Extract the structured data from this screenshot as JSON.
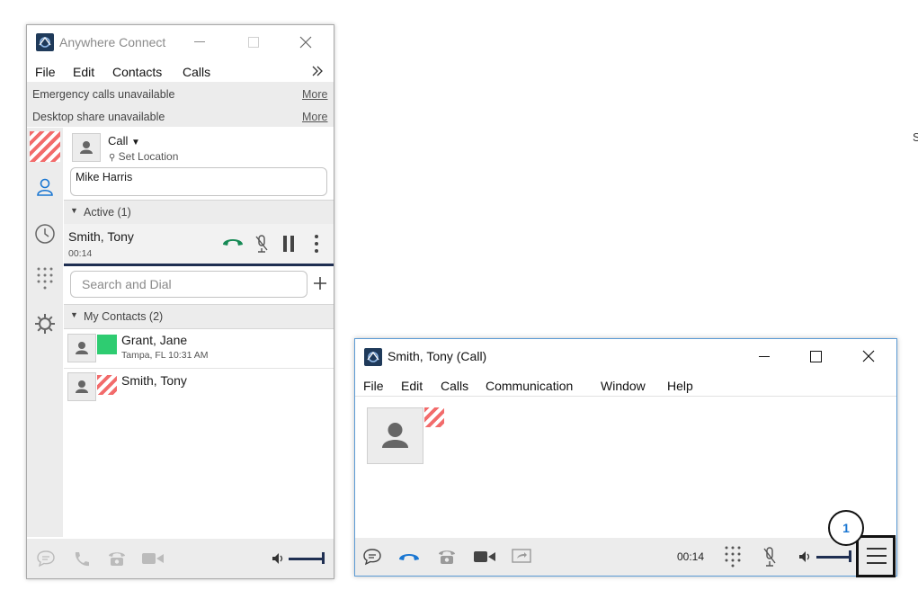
{
  "main_window": {
    "title": "Anywhere Connect",
    "menu": [
      "File",
      "Edit",
      "Contacts",
      "Calls"
    ],
    "notices": [
      {
        "text": "Emergency calls unavailable",
        "link": "More"
      },
      {
        "text": "Desktop share unavailable",
        "link": "More"
      }
    ],
    "call_panel": {
      "mode": "Call",
      "location": "Set Location",
      "input_value": "Mike Harris"
    },
    "active_section": "Active (1)",
    "active_call": {
      "name": "Smith, Tony",
      "duration": "00:14"
    },
    "search_placeholder": "Search and Dial",
    "contacts_section": "My Contacts (2)",
    "contacts": [
      {
        "name": "Grant, Jane",
        "detail": "Tampa, FL 10:31 AM",
        "status_color": "#2ecc71"
      },
      {
        "name": "Smith, Tony",
        "detail": "",
        "status_color": "#f26b6b"
      }
    ]
  },
  "call_window": {
    "title": "Smith, Tony (Call)",
    "menu": [
      "File",
      "Edit",
      "Calls",
      "Communication",
      "Window",
      "Help"
    ],
    "timer": "00:14",
    "callout": "1"
  },
  "edge_text": "S",
  "colors": {
    "accent_blue": "#1976d2",
    "call_green": "#168a55",
    "presence_green": "#2ecc71",
    "presence_red": "#f26b6b",
    "highlight_border": "#111111"
  },
  "icons": {
    "contacts": "person-icon",
    "history": "clock-icon",
    "dialpad": "dialpad-icon",
    "settings": "gear-icon",
    "chat": "chat-icon",
    "phone": "phone-icon",
    "deskphone": "deskphone-icon",
    "video": "video-icon",
    "screen_share": "share-screen-icon",
    "mute": "mic-muted-icon",
    "hold": "pause-icon",
    "more": "kebab-icon",
    "volume": "speaker-icon",
    "menu": "hamburger-icon"
  }
}
